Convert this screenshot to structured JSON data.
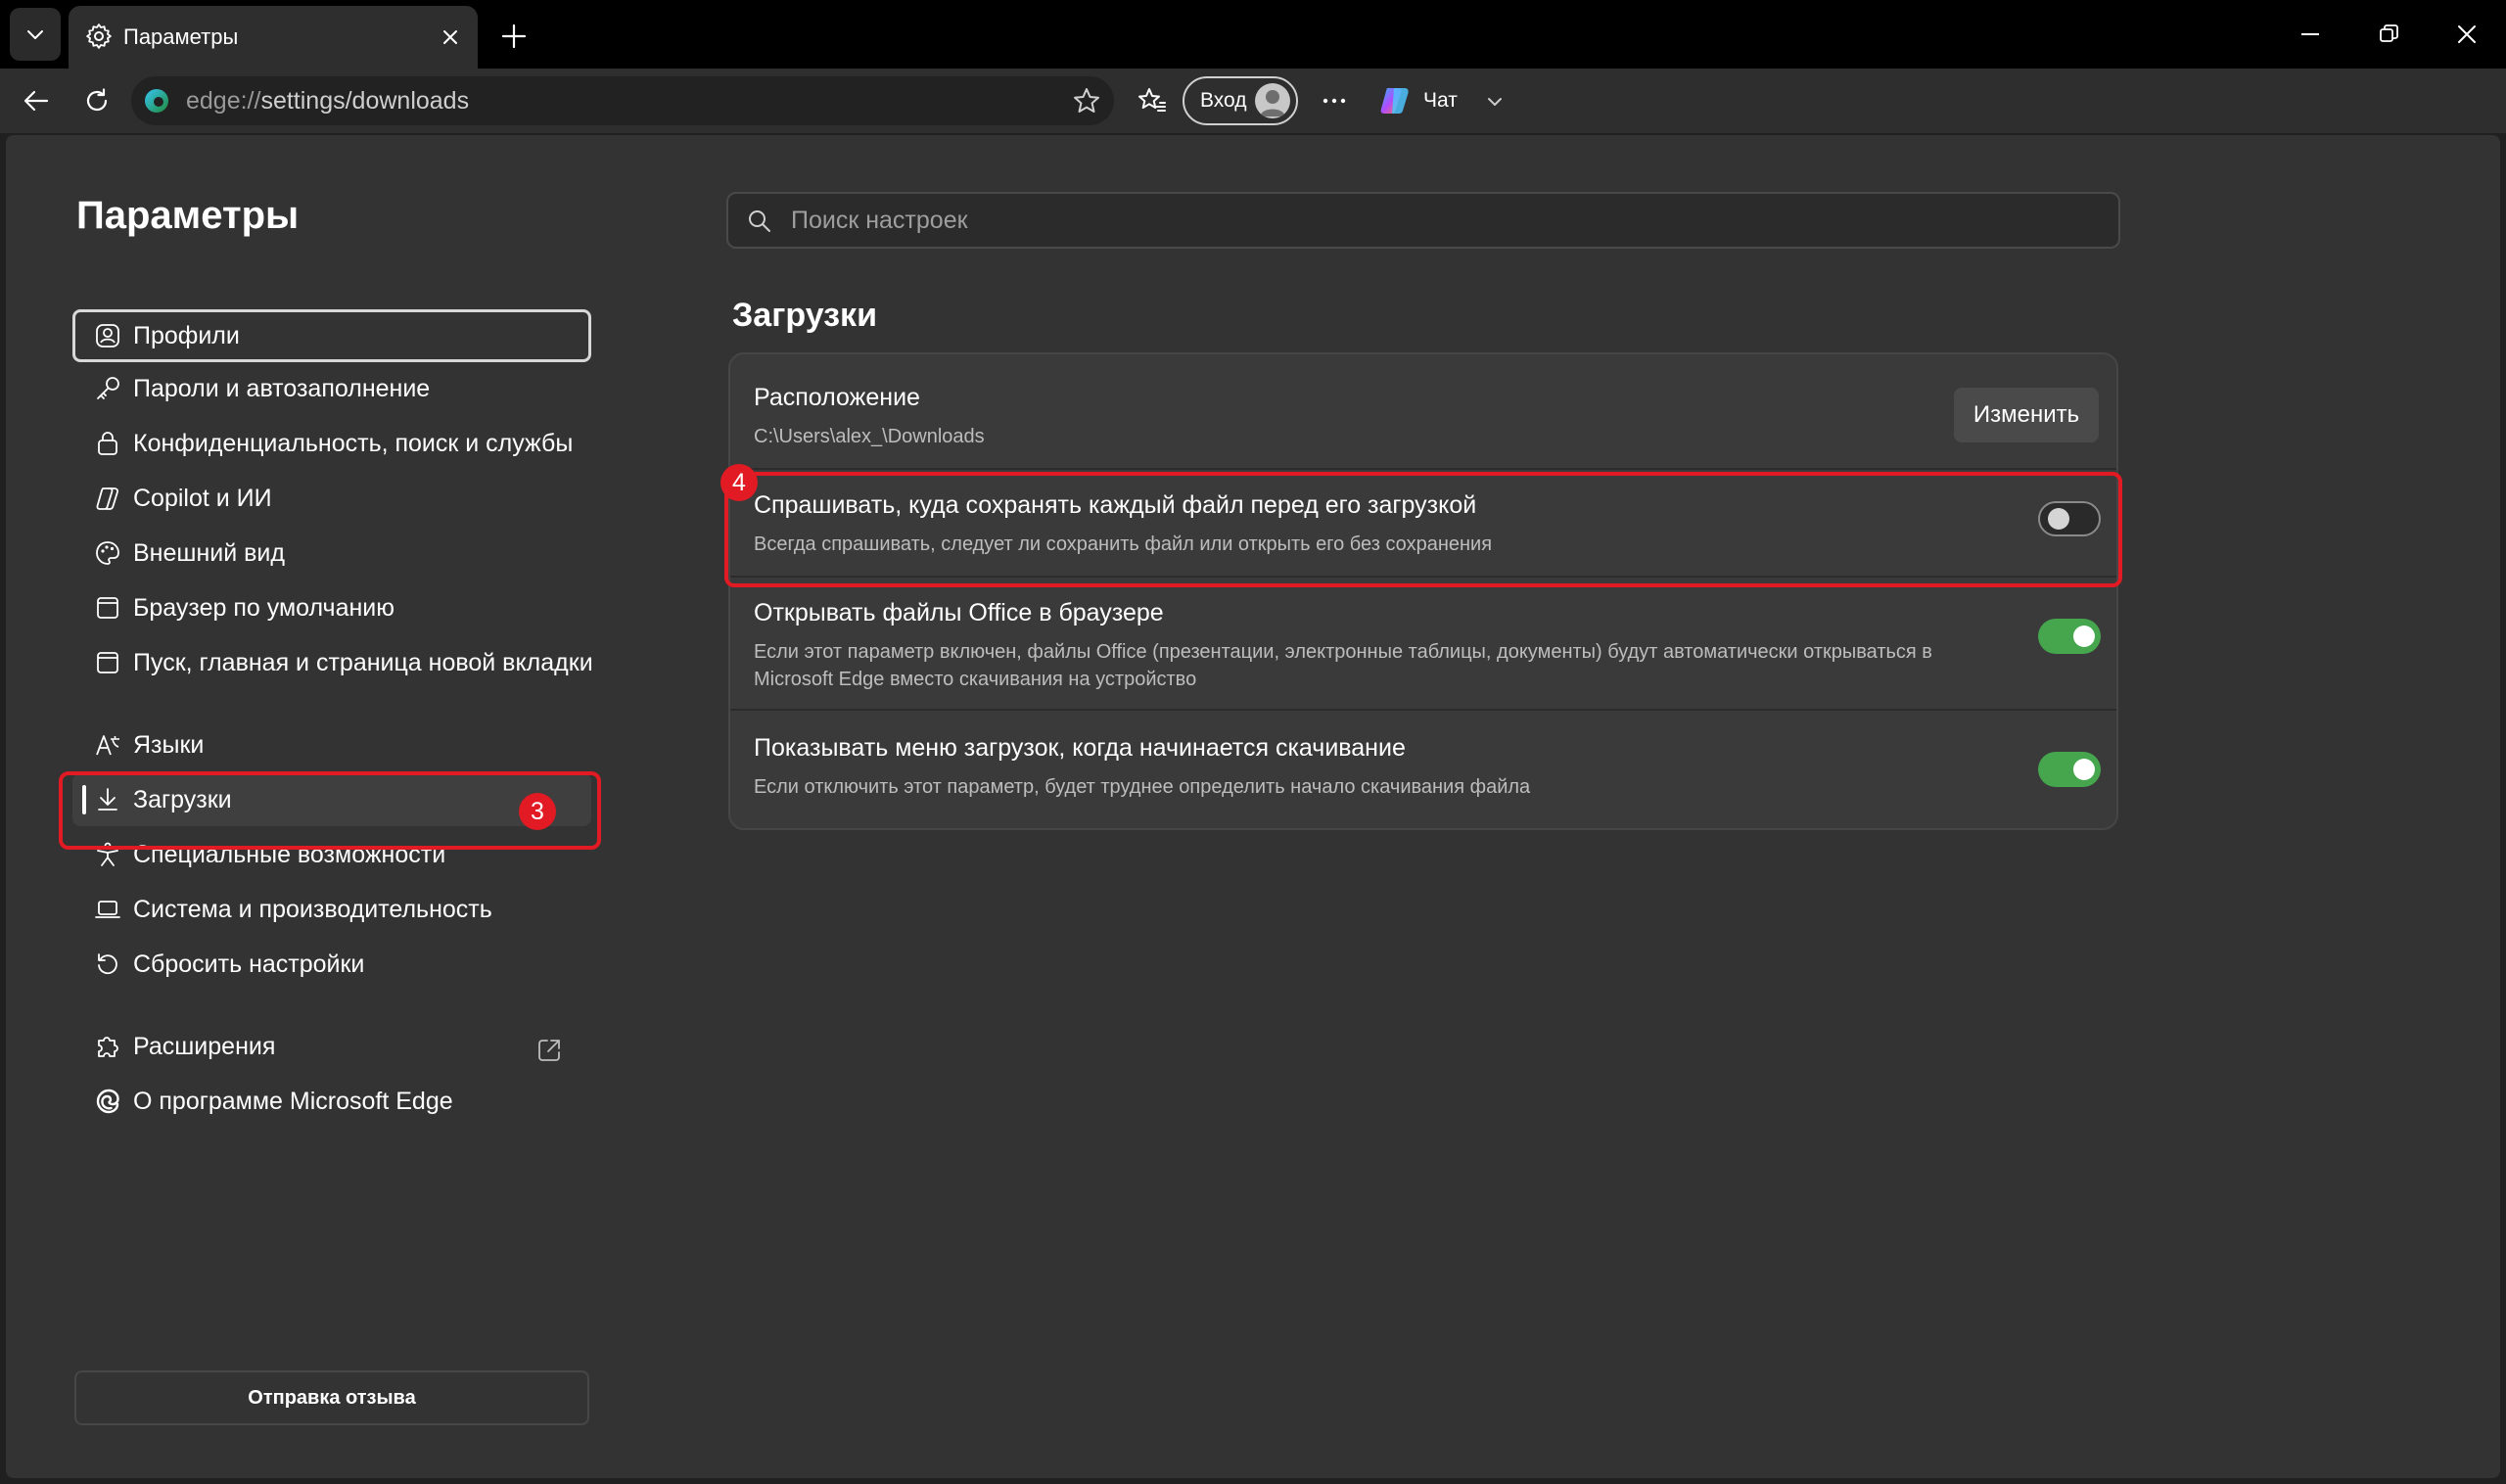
{
  "browser": {
    "tab": {
      "title": "Параметры",
      "icon": "gear-icon"
    },
    "address": {
      "scheme": "edge://",
      "path": "settings/downloads"
    },
    "signin_label": "Вход",
    "chat_label": "Чат"
  },
  "sidebar": {
    "title": "Параметры",
    "items": [
      {
        "label": "Профили",
        "icon": "profile-icon"
      },
      {
        "label": "Пароли и автозаполнение",
        "icon": "key-icon"
      },
      {
        "label": "Конфиденциальность, поиск и службы",
        "icon": "lock-icon"
      },
      {
        "label": "Copilot и ИИ",
        "icon": "copilot-icon"
      },
      {
        "label": "Внешний вид",
        "icon": "palette-icon"
      },
      {
        "label": "Браузер по умолчанию",
        "icon": "browser-icon"
      },
      {
        "label": "Пуск, главная и страница новой вкладки",
        "icon": "home-icon"
      },
      {
        "label": "Языки",
        "icon": "language-icon"
      },
      {
        "label": "Загрузки",
        "icon": "download-icon",
        "active": true
      },
      {
        "label": "Специальные возможности",
        "icon": "accessibility-icon"
      },
      {
        "label": "Система и производительность",
        "icon": "laptop-icon"
      },
      {
        "label": "Сбросить настройки",
        "icon": "reset-icon"
      },
      {
        "label": "Расширения",
        "icon": "puzzle-icon"
      },
      {
        "label": "О программе Microsoft Edge",
        "icon": "edge-icon"
      }
    ],
    "feedback_label": "Отправка отзыва"
  },
  "search": {
    "placeholder": "Поиск настроек"
  },
  "downloads": {
    "title": "Загрузки",
    "location": {
      "title": "Расположение",
      "path": "C:\\Users\\alex_\\Downloads",
      "change_label": "Изменить"
    },
    "ask_where": {
      "title": "Спрашивать, куда сохранять каждый файл перед его загрузкой",
      "desc": "Всегда спрашивать, следует ли сохранить файл или открыть его без сохранения",
      "enabled": false
    },
    "office_files": {
      "title": "Открывать файлы Office в браузере",
      "desc": "Если этот параметр включен, файлы Office (презентации, электронные таблицы, документы) будут автоматически открываться в Microsoft Edge вместо скачивания на устройство",
      "enabled": true
    },
    "show_menu": {
      "title": "Показывать меню загрузок, когда начинается скачивание",
      "desc": "Если отключить этот параметр, будет труднее определить начало скачивания файла",
      "enabled": true
    }
  },
  "annotations": {
    "step_sidebar": "3",
    "step_toggle": "4",
    "color": "#e21a23"
  },
  "colors": {
    "toggle_on": "#45a64e",
    "page_bg": "#333333",
    "chrome_bg": "#000000"
  }
}
